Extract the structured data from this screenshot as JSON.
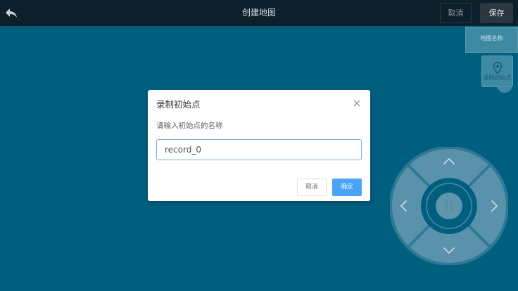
{
  "header": {
    "back_icon": "back-arrow-icon",
    "title": "创建地图",
    "cancel_label": "取消",
    "save_label": "保存"
  },
  "side_tools": {
    "map_name_label": "地图名称",
    "record_start_label": "录制初始点",
    "record_start_icon": "location-pin-plus-icon"
  },
  "joystick": {
    "up_icon": "chevron-up-icon",
    "down_icon": "chevron-down-icon",
    "left_icon": "chevron-left-icon",
    "right_icon": "chevron-right-icon",
    "center_icon": "pause-icon"
  },
  "dialog": {
    "title": "录制初始点",
    "prompt": "请输入初始点的名称",
    "input_value": "record_0",
    "cancel_label": "取消",
    "ok_label": "确定",
    "close_icon": "close-icon"
  },
  "colors": {
    "background": "#005f7f",
    "topbar": "#0d1f2b",
    "primary": "#4aa3f5",
    "tool_panel": "#3f8aa3"
  }
}
